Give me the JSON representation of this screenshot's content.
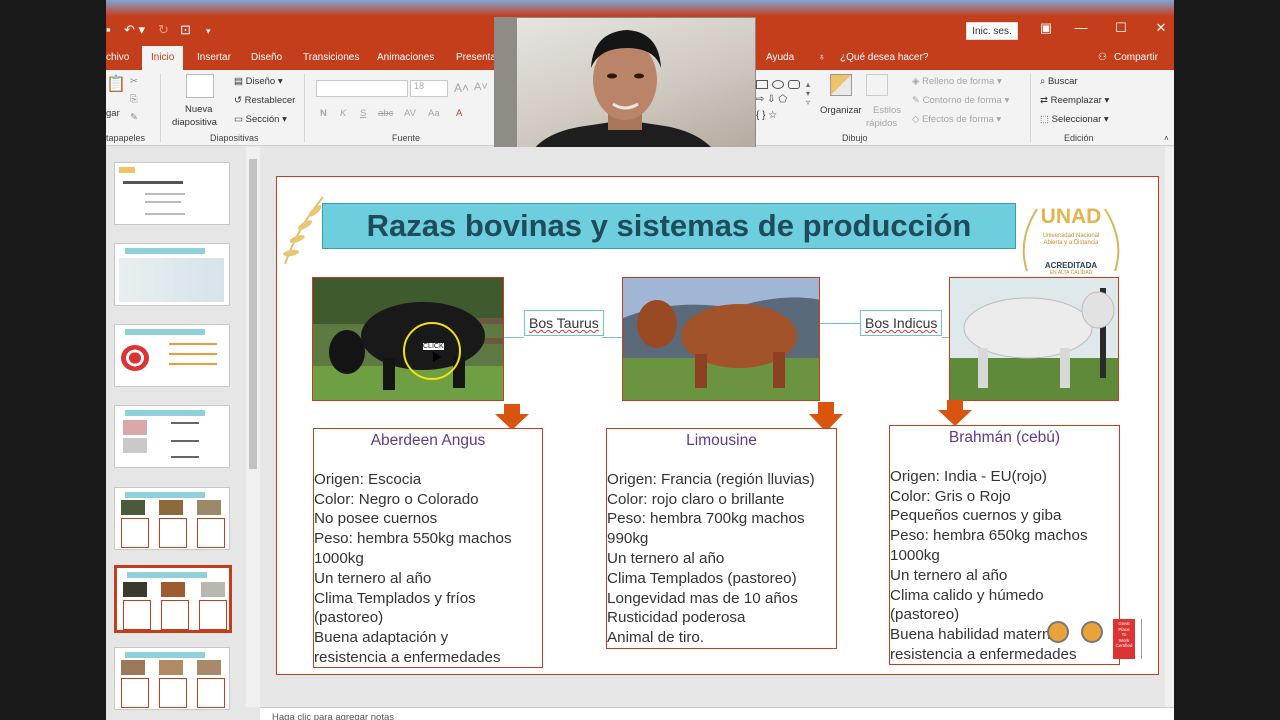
{
  "titlebar": {
    "signin": "Inic. ses."
  },
  "tabs": [
    "chivo",
    "Inicio",
    "Insertar",
    "Diseño",
    "Transiciones",
    "Animaciones",
    "Presenta",
    "Ayuda",
    "¿Qué desea hacer?",
    "Compartir"
  ],
  "ribbon": {
    "slides": {
      "new_slide": "Nueva",
      "new_slide2": "diapositiva",
      "layout": "Diseño",
      "reset": "Restablecer",
      "section": "Sección",
      "group": "Diapositivas"
    },
    "clipboard": {
      "paste": "gar",
      "group": "tapapeles"
    },
    "font": {
      "size": "18",
      "group": "Fuente",
      "bold": "N",
      "italic": "K",
      "underline": "S",
      "strike": "abc",
      "spacing": "AV",
      "case": "Aa"
    },
    "drawing": {
      "arrange": "Organizar",
      "styles1": "Estilos",
      "styles2": "rápidos",
      "fill": "Relleno de forma",
      "outline": "Contorno de forma",
      "effects": "Efectos de forma",
      "group": "Dibujo"
    },
    "editing": {
      "find": "Buscar",
      "replace": "Reemplazar",
      "select": "Seleccionar",
      "group": "Edición"
    }
  },
  "slide": {
    "title": "Razas bovinas y sistemas de producción",
    "logo": {
      "name": "UNAD",
      "sub1": "Universidad Nacional",
      "sub2": "Abierta y a Distancia",
      "badge": "ACREDITADA",
      "badge2": "EN ALTA CALIDAD"
    },
    "labels": {
      "taurus": "Bos Taurus",
      "indicus": "Bos Indicus"
    },
    "cards": [
      {
        "title": "Aberdeen Angus",
        "lines": [
          "Origen: Escocia",
          "Color: Negro o Colorado",
          "No posee cuernos",
          "Peso: hembra 550kg machos",
          "1000kg",
          "Un ternero al año",
          "Clima Templados y fríos",
          "(pastoreo)",
          "Buena adaptación y",
          "resistencia a enfermedades"
        ]
      },
      {
        "title": "Limousine",
        "lines": [
          "Origen: Francia (región lluvias)",
          "Color: rojo claro o brillante",
          "Peso: hembra 700kg machos",
          "990kg",
          "Un ternero al año",
          "Clima Templados (pastoreo)",
          "Longevidad mas de 10 años",
          "Rusticidad poderosa",
          "Animal de tiro."
        ]
      },
      {
        "title": "Brahmán (cebú)",
        "lines": [
          "Origen: India - EU(rojo)",
          "Color: Gris o Rojo",
          "Pequeños cuernos y giba",
          "Peso: hembra 650kg machos",
          "1000kg",
          "Un ternero al año",
          "Clima calido y húmedo",
          "(pastoreo)",
          "Buena habilidad materna",
          "resistencia a enfermedades"
        ]
      }
    ],
    "cursor_text": "CLICK",
    "badges": {
      "gptw1": "Great",
      "gptw2": "Place",
      "gptw3": "To",
      "gptw4": "Work",
      "gptw5": "Certified"
    }
  },
  "thumbnails": {
    "t1_title": "Razas bovinas y sistemas de producción"
  },
  "notes": "Haga clic para agregar notas"
}
